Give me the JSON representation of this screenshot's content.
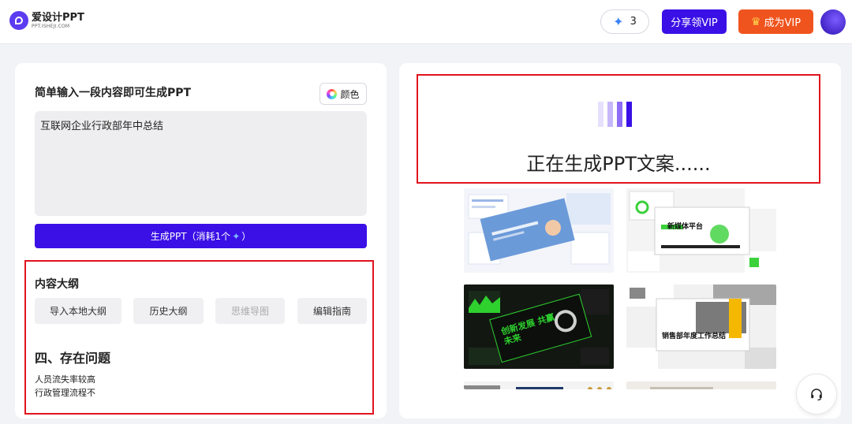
{
  "header": {
    "logo_name": "爱设计PPT",
    "logo_sub": "PPT.ISHEJI.COM",
    "credits_count": "3",
    "share_label": "分享领VIP",
    "vip_label": "成为VIP"
  },
  "editor": {
    "title": "简单输入一段内容即可生成PPT",
    "color_label": "颜色",
    "input_value": "互联网企业行政部年中总结",
    "generate_label": "生成PPT（消耗1个",
    "generate_suffix": "）"
  },
  "outline": {
    "title": "内容大纲",
    "tabs": [
      "导入本地大纲",
      "历史大纲",
      "思维导图",
      "编辑指南"
    ],
    "section_heading": "四、存在问题",
    "items": [
      "人员流失率较高",
      "行政管理流程不"
    ]
  },
  "preview": {
    "status_text": "正在生成PPT文案......",
    "thumb_labels": {
      "t2_title": "新媒体平台",
      "t3_title": "创新发展 共赢未来",
      "t4_title": "销售部年度工作总结"
    }
  },
  "colors": {
    "primary": "#3a10e6",
    "vip": "#f0541e",
    "highlight_border": "#e0141e"
  },
  "icons": [
    "logo-icon",
    "sparkle-icon",
    "crown-icon",
    "color-wheel-icon",
    "loading-bars-icon",
    "headset-icon"
  ]
}
